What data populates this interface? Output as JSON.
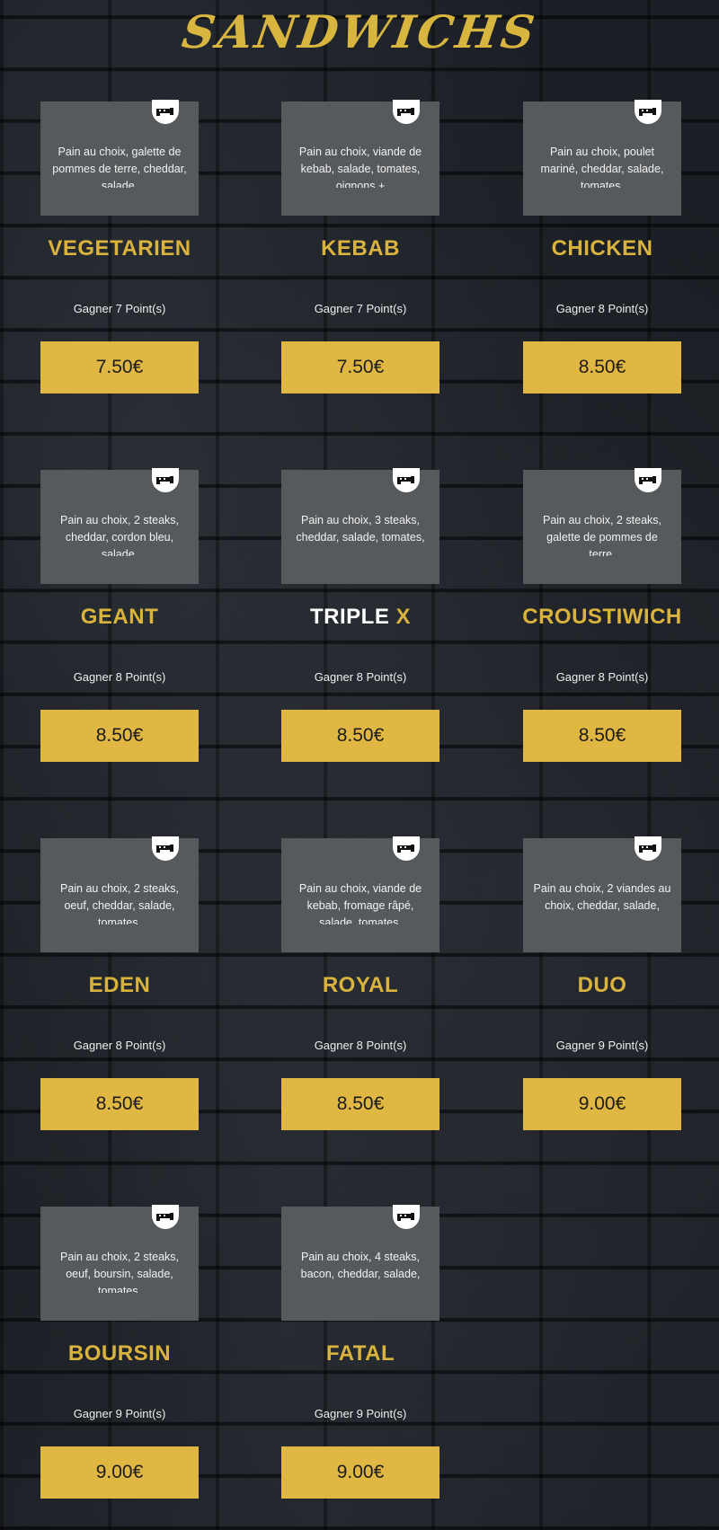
{
  "page_title": "SANDWICHS",
  "colors": {
    "accent_gold": "#d9b33e",
    "price_button_bg": "#e0b742",
    "card_bg": "#575a5d"
  },
  "badge_icon": "sandwich-icon",
  "products": [
    {
      "name": "VEGETARIEN",
      "description": "Pain au choix, galette de pommes de terre, cheddar, salade,",
      "points": "Gagner 7 Point(s)",
      "price": "7.50€"
    },
    {
      "name": "KEBAB",
      "description": "Pain au choix, viande de kebab, salade, tomates, oignons +",
      "points": "Gagner 7 Point(s)",
      "price": "7.50€"
    },
    {
      "name": "CHICKEN",
      "description": "Pain au choix, poulet mariné, cheddar, salade, tomates,",
      "points": "Gagner 8 Point(s)",
      "price": "8.50€"
    },
    {
      "name": "GEANT",
      "description": "Pain au choix, 2 steaks, cheddar, cordon bleu, salade,",
      "points": "Gagner 8 Point(s)",
      "price": "8.50€"
    },
    {
      "name_part1": "TRIPLE ",
      "name_part2": "X",
      "description": "Pain au choix, 3 steaks, cheddar, salade, tomates,",
      "points": "Gagner 8 Point(s)",
      "price": "8.50€"
    },
    {
      "name": "CROUSTIWICH",
      "description": "Pain au choix, 2 steaks, galette de pommes de terre,",
      "points": "Gagner 8 Point(s)",
      "price": "8.50€"
    },
    {
      "name": "EDEN",
      "description": "Pain au choix, 2 steaks, oeuf, cheddar, salade, tomates,",
      "points": "Gagner 8 Point(s)",
      "price": "8.50€"
    },
    {
      "name": "ROYAL",
      "description": "Pain au choix, viande de kebab, fromage râpé, salade, tomates,",
      "points": "Gagner 8 Point(s)",
      "price": "8.50€"
    },
    {
      "name": "DUO",
      "description": "Pain au choix, 2 viandes au choix, cheddar, salade,",
      "points": "Gagner 9 Point(s)",
      "price": "9.00€"
    },
    {
      "name": "BOURSIN",
      "description": "Pain au choix, 2 steaks, oeuf, boursin, salade, tomates,",
      "points": "Gagner 9 Point(s)",
      "price": "9.00€"
    },
    {
      "name": "FATAL",
      "description": "Pain au choix, 4 steaks, bacon, cheddar, salade,",
      "points": "Gagner 9 Point(s)",
      "price": "9.00€"
    }
  ]
}
